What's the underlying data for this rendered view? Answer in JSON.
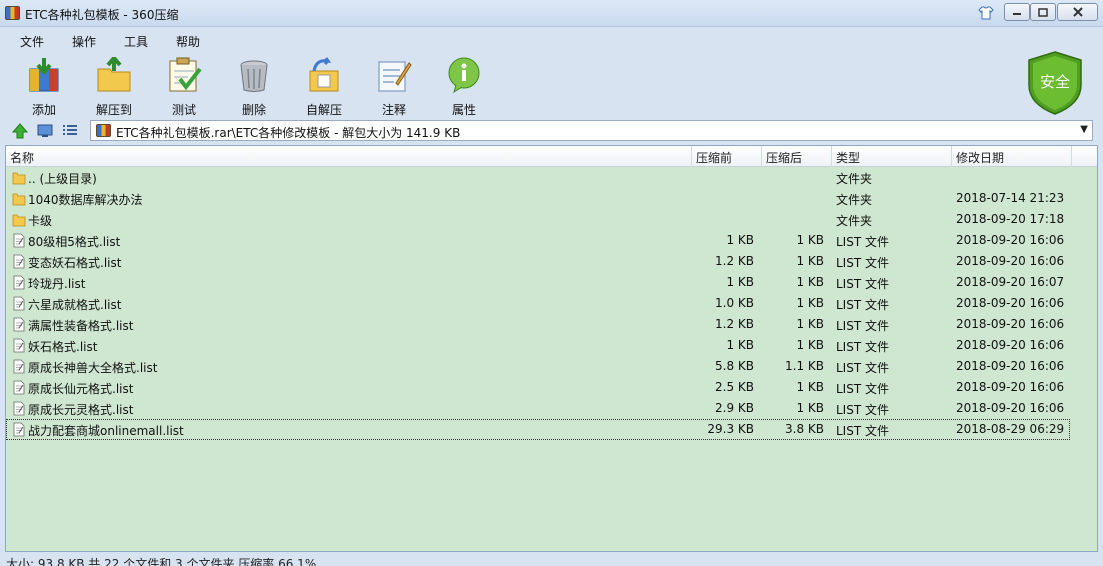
{
  "window": {
    "title": "ETC各种礼包模板 - 360压缩",
    "icons": [
      "app-icon",
      "skin-shirt-icon",
      "minimize-icon",
      "maximize-icon",
      "close-icon"
    ]
  },
  "menu": [
    "文件",
    "操作",
    "工具",
    "帮助"
  ],
  "toolbar": [
    {
      "label": "添加",
      "icon": "add-archive-icon"
    },
    {
      "label": "解压到",
      "icon": "extract-to-icon"
    },
    {
      "label": "测试",
      "icon": "test-clipboard-icon"
    },
    {
      "label": "删除",
      "icon": "delete-trash-icon"
    },
    {
      "label": "自解压",
      "icon": "self-extract-icon"
    },
    {
      "label": "注释",
      "icon": "comment-note-icon"
    },
    {
      "label": "属性",
      "icon": "info-properties-icon"
    }
  ],
  "security_badge": {
    "label": "安全",
    "color": "#5aab2a"
  },
  "address": {
    "path": "ETC各种礼包模板.rar\\ETC各种修改模板 - 解包大小为 141.9 KB",
    "icons": [
      "up-arrow-icon",
      "thumbnail-view-icon",
      "details-view-icon",
      "archive-icon",
      "dropdown-arrow-icon"
    ]
  },
  "columns": [
    "名称",
    "压缩前",
    "压缩后",
    "类型",
    "修改日期"
  ],
  "files": [
    {
      "name": ".. (上级目录)",
      "packed": "",
      "compressed": "",
      "type": "文件夹",
      "date": "",
      "kind": "folder"
    },
    {
      "name": "1040数据库解决办法",
      "packed": "",
      "compressed": "",
      "type": "文件夹",
      "date": "2018-07-14 21:23",
      "kind": "folder"
    },
    {
      "name": "卡级",
      "packed": "",
      "compressed": "",
      "type": "文件夹",
      "date": "2018-09-20 17:18",
      "kind": "folder"
    },
    {
      "name": "80级相5格式.list",
      "packed": "1 KB",
      "compressed": "1 KB",
      "type": "LIST 文件",
      "date": "2018-09-20 16:06",
      "kind": "file"
    },
    {
      "name": "变态妖石格式.list",
      "packed": "1.2 KB",
      "compressed": "1 KB",
      "type": "LIST 文件",
      "date": "2018-09-20 16:06",
      "kind": "file"
    },
    {
      "name": "玲珑丹.list",
      "packed": "1 KB",
      "compressed": "1 KB",
      "type": "LIST 文件",
      "date": "2018-09-20 16:07",
      "kind": "file"
    },
    {
      "name": "六星成就格式.list",
      "packed": "1.0 KB",
      "compressed": "1 KB",
      "type": "LIST 文件",
      "date": "2018-09-20 16:06",
      "kind": "file"
    },
    {
      "name": "满属性装备格式.list",
      "packed": "1.2 KB",
      "compressed": "1 KB",
      "type": "LIST 文件",
      "date": "2018-09-20 16:06",
      "kind": "file"
    },
    {
      "name": "妖石格式.list",
      "packed": "1 KB",
      "compressed": "1 KB",
      "type": "LIST 文件",
      "date": "2018-09-20 16:06",
      "kind": "file"
    },
    {
      "name": "原成长神兽大全格式.list",
      "packed": "5.8 KB",
      "compressed": "1.1 KB",
      "type": "LIST 文件",
      "date": "2018-09-20 16:06",
      "kind": "file"
    },
    {
      "name": "原成长仙元格式.list",
      "packed": "2.5 KB",
      "compressed": "1 KB",
      "type": "LIST 文件",
      "date": "2018-09-20 16:06",
      "kind": "file"
    },
    {
      "name": "原成长元灵格式.list",
      "packed": "2.9 KB",
      "compressed": "1 KB",
      "type": "LIST 文件",
      "date": "2018-09-20 16:06",
      "kind": "file"
    },
    {
      "name": "战力配套商城onlinemall.list",
      "packed": "29.3 KB",
      "compressed": "3.8 KB",
      "type": "LIST 文件",
      "date": "2018-08-29 06:29",
      "kind": "file",
      "selected": true
    }
  ],
  "list_background": "#cfe7d0",
  "status": "大小: 93.8 KB 共 22 个文件和 3 个文件夹 压缩率 66.1%"
}
